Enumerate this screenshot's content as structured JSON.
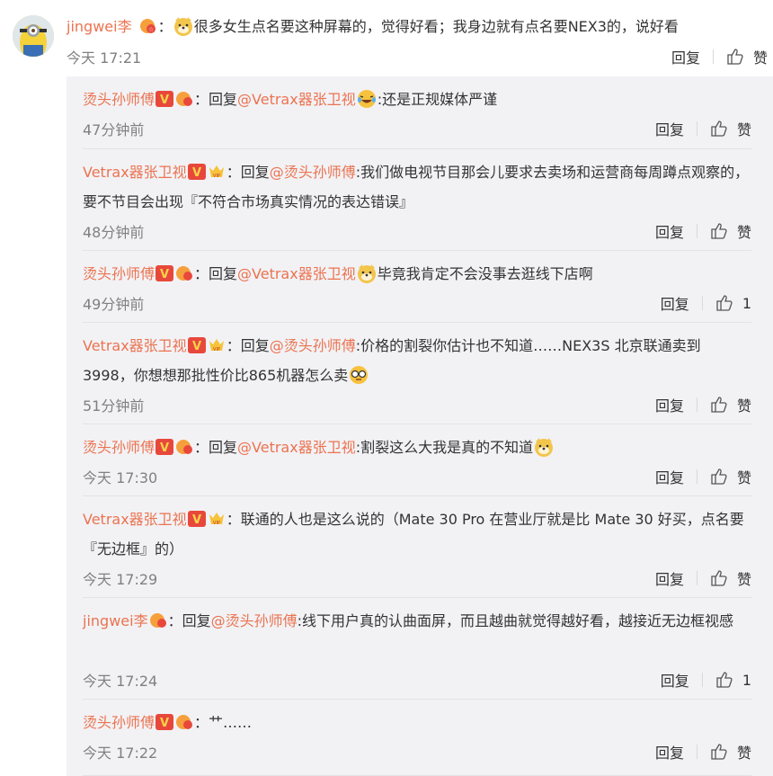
{
  "main": {
    "user": "jingwei李",
    "colon": "：",
    "text": "很多女生点名要这种屏幕的，觉得好看；我身边就有点名要NEX3的，说好看",
    "time": "今天 17:21",
    "reply_label": "回复",
    "like_label": "赞"
  },
  "replies": [
    {
      "user": "烫头孙师傅",
      "badge": "v-red",
      "prefix": "：回复",
      "mention": "@Vetrax器张卫视",
      "text": ":还是正规媒体严谨",
      "emoji": "laugh-cry",
      "time": "47分钟前",
      "reply_label": "回复",
      "like_label": "赞"
    },
    {
      "user": "Vetrax器张卫视",
      "badge": "v-vip",
      "prefix": "：回复",
      "mention": "@烫头孙师傅",
      "text": ":我们做电视节目那会儿要求去卖场和运营商每周蹲点观察的，要不节目会出现『不符合市场真实情况的表达错误』",
      "time": "48分钟前",
      "reply_label": "回复",
      "like_label": "赞"
    },
    {
      "user": "烫头孙师傅",
      "badge": "v-red",
      "prefix": "：回复",
      "mention": "@Vetrax器张卫视",
      "text": "毕竟我肯定不会没事去逛线下店啊",
      "emoji": "doge",
      "time": "49分钟前",
      "reply_label": "回复",
      "like_label": "1"
    },
    {
      "user": "Vetrax器张卫视",
      "badge": "v-vip",
      "prefix": "：回复",
      "mention": "@烫头孙师傅",
      "text": ":价格的割裂你估计也不知道……NEX3S 北京联通卖到3998，你想想那批性价比865机器怎么卖",
      "emoji": "glasses",
      "time": "51分钟前",
      "reply_label": "回复",
      "like_label": "赞"
    },
    {
      "user": "烫头孙师傅",
      "badge": "v-red",
      "prefix": "：回复",
      "mention": "@Vetrax器张卫视",
      "text": ":割裂这么大我是真的不知道",
      "emoji": "doge",
      "time": "今天 17:30",
      "reply_label": "回复",
      "like_label": "赞"
    },
    {
      "user": "Vetrax器张卫视",
      "badge": "v-vip",
      "prefix": "：",
      "mention": "",
      "text": "联通的人也是这么说的（Mate 30 Pro 在营业厅就是比 Mate 30 好买，点名要『无边框』的）",
      "time": "今天 17:29",
      "reply_label": "回复",
      "like_label": "赞"
    },
    {
      "user": "jingwei李",
      "badge": "fan",
      "prefix": "：回复",
      "mention": "@烫头孙师傅",
      "text": ":线下用户真的认曲面屏，而且越曲就觉得越好看，越接近无边框视感",
      "time": "今天 17:24",
      "reply_label": "回复",
      "like_label": "1"
    },
    {
      "user": "烫头孙师傅",
      "badge": "v-red",
      "prefix": "：",
      "mention": "",
      "text": "艹……",
      "time": "今天 17:22",
      "reply_label": "回复",
      "like_label": "赞"
    }
  ],
  "colors": {
    "accent": "#eb7350",
    "panel": "#f2f2f5",
    "meta": "#808080"
  }
}
